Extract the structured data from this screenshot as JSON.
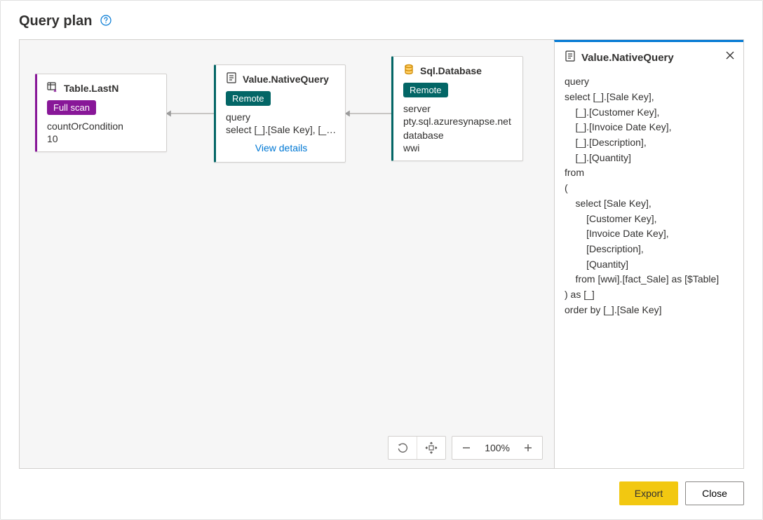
{
  "title": "Query plan",
  "nodes": {
    "n1": {
      "title": "Table.LastN",
      "badge": "Full scan",
      "param_label": "countOrCondition",
      "param_value": "10"
    },
    "n2": {
      "title": "Value.NativeQuery",
      "badge": "Remote",
      "param_label": "query",
      "param_value": "select [_].[Sale Key], [_]....",
      "link": "View details"
    },
    "n3": {
      "title": "Sql.Database",
      "badge": "Remote",
      "p1_label": "server",
      "p1_value": "pty.sql.azuresynapse.net",
      "p2_label": "database",
      "p2_value": "wwi"
    }
  },
  "zoom": "100%",
  "panel": {
    "title": "Value.NativeQuery",
    "label": "query",
    "body": "select [_].[Sale Key],\n    [_].[Customer Key],\n    [_].[Invoice Date Key],\n    [_].[Description],\n    [_].[Quantity]\nfrom\n(\n    select [Sale Key],\n        [Customer Key],\n        [Invoice Date Key],\n        [Description],\n        [Quantity]\n    from [wwi].[fact_Sale] as [$Table]\n) as [_]\norder by [_].[Sale Key]"
  },
  "buttons": {
    "export": "Export",
    "close": "Close"
  }
}
